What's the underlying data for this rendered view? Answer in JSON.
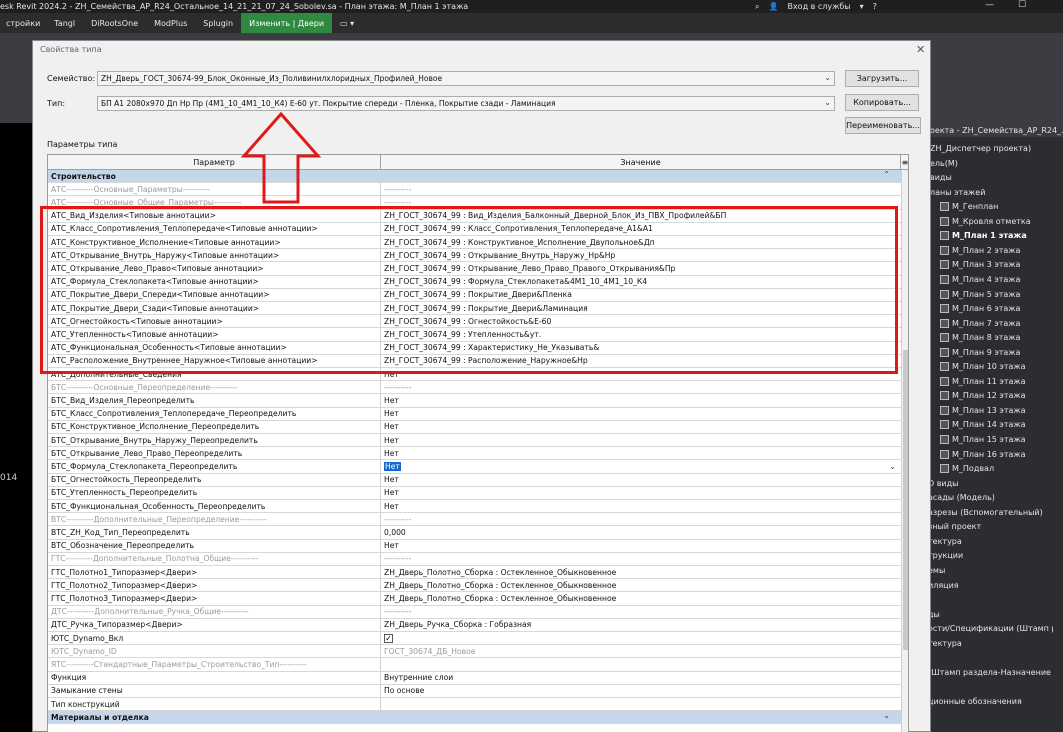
{
  "titlebar": {
    "text": "esk Revit 2024.2 - ZH_Семейства_АР_R24_Остальное_14_21_21_07_24_Sobolev.sa - План этажа: М_План 1 этажа",
    "login": "Вход в службы"
  },
  "menu": [
    "стройки",
    "Tangl",
    "DiRootsOne",
    "ModPlus",
    "Splugin",
    "Изменить | Двери"
  ],
  "dialog": {
    "title": "Свойства типа",
    "family_label": "Семейство:",
    "family_value": "ZH_Дверь_ГОСТ_30674-99_Блок_Оконные_Из_Поливинилхлоридных_Профилей_Новое",
    "type_label": "Тип:",
    "type_value": "БП А1 2080х970 Дп Нр Пр (4М1_10_4М1_10_К4) Е-60 ут.  Покрытие спереди - Пленка, Покрытие сзади - Ламинация",
    "load_button": "Загрузить...",
    "copy_button": "Копировать...",
    "rename_button": "Переименовать...",
    "params_label": "Параметры типа",
    "col_param": "Параметр",
    "col_value": "Значение"
  },
  "rows": [
    {
      "p": "Строительство",
      "v": "",
      "kind": "group"
    },
    {
      "p": "АТС----------Основные_Параметры----------",
      "v": "----------",
      "kind": "grey"
    },
    {
      "p": "АТС----------Основные_Общие_Параметры----------",
      "v": "----------",
      "kind": "grey"
    },
    {
      "p": "АТС_Вид_Изделия<Типовые аннотации>",
      "v": "ZH_ГОСТ_30674_99 : Вид_Изделия_Балконный_Дверной_Блок_Из_ПВХ_Профилей&БП",
      "kind": ""
    },
    {
      "p": "АТС_Класс_Сопротивления_Теплопередаче<Типовые аннотации>",
      "v": "ZH_ГОСТ_30674_99 : Класс_Сопротивления_Теплопередаче_А1&А1",
      "kind": ""
    },
    {
      "p": "АТС_Конструктивное_Исполнение<Типовые аннотации>",
      "v": "ZH_ГОСТ_30674_99 : Конструктивное_Исполнение_Двупольное&Дп",
      "kind": ""
    },
    {
      "p": "АТС_Открывание_Внутрь_Наружу<Типовые аннотации>",
      "v": "ZH_ГОСТ_30674_99 : Открывание_Внутрь_Наружу_Нр&Нр",
      "kind": ""
    },
    {
      "p": "АТС_Открывание_Лево_Право<Типовые аннотации>",
      "v": "ZH_ГОСТ_30674_99 : Открывание_Лево_Право_Правого_Открывания&Пр",
      "kind": ""
    },
    {
      "p": "АТС_Формула_Стеклопакета<Типовые аннотации>",
      "v": "ZH_ГОСТ_30674_99 : Формула_Стеклопакета&4М1_10_4М1_10_К4",
      "kind": ""
    },
    {
      "p": "АТС_Покрытие_Двери_Спереди<Типовые аннотации>",
      "v": "ZH_ГОСТ_30674_99 : Покрытие_Двери&Пленка",
      "kind": ""
    },
    {
      "p": "АТС_Покрытие_Двери_Сзади<Типовые аннотации>",
      "v": "ZH_ГОСТ_30674_99 : Покрытие_Двери&Ламинация",
      "kind": ""
    },
    {
      "p": "АТС_Огнестойкость<Типовые аннотации>",
      "v": "ZH_ГОСТ_30674_99 : Огнестойкость&Е-60",
      "kind": ""
    },
    {
      "p": "АТС_Утепленность<Типовые аннотации>",
      "v": "ZH_ГОСТ_30674_99 : Утепленность&ут.",
      "kind": ""
    },
    {
      "p": "АТС_Функциональная_Особенность<Типовые аннотации>",
      "v": "ZH_ГОСТ_30674_99 : Характеристику_Не_Указывать&",
      "kind": ""
    },
    {
      "p": "АТС_Расположение_Внутреннее_Наружное<Типовые аннотации>",
      "v": "ZH_ГОСТ_30674_99 : Расположение_Наружное&Нр",
      "kind": ""
    },
    {
      "p": "АТС_Дополнительные_Сведения",
      "v": "Нет",
      "kind": ""
    },
    {
      "p": "БТС----------Основные_Переопределение----------",
      "v": "----------",
      "kind": "grey"
    },
    {
      "p": "БТС_Вид_Изделия_Переопределить",
      "v": "Нет",
      "kind": ""
    },
    {
      "p": "БТС_Класс_Сопротивления_Теплопередаче_Переопределить",
      "v": "Нет",
      "kind": ""
    },
    {
      "p": "БТС_Конструктивное_Исполнение_Переопределить",
      "v": "Нет",
      "kind": ""
    },
    {
      "p": "БТС_Открывание_Внутрь_Наружу_Переопределить",
      "v": "Нет",
      "kind": ""
    },
    {
      "p": "БТС_Открывание_Лево_Право_Переопределить",
      "v": "Нет",
      "kind": ""
    },
    {
      "p": "БТС_Формула_Стеклопакета_Переопределить",
      "v": "Нет",
      "kind": "selected"
    },
    {
      "p": "БТС_Огнестойкость_Переопределить",
      "v": "Нет",
      "kind": ""
    },
    {
      "p": "БТС_Утепленность_Переопределить",
      "v": "Нет",
      "kind": ""
    },
    {
      "p": "БТС_Функциональная_Особенность_Переопределить",
      "v": "Нет",
      "kind": ""
    },
    {
      "p": "ВТС----------Дополнительные_Переопределение----------",
      "v": "----------",
      "kind": "grey"
    },
    {
      "p": "ВТС_ZH_Код_Тип_Переопределить",
      "v": "0,000",
      "kind": ""
    },
    {
      "p": "ВТС_Обозначение_Переопределить",
      "v": "Нет",
      "kind": ""
    },
    {
      "p": "ГТС----------Дополнительные_Полотна_Общие----------",
      "v": "----------",
      "kind": "grey"
    },
    {
      "p": "ГТС_Полотно1_Типоразмер<Двери>",
      "v": "ZH_Дверь_Полотно_Сборка : Остекленное_Обыкновенное",
      "kind": ""
    },
    {
      "p": "ГТС_Полотно2_Типоразмер<Двери>",
      "v": "ZH_Дверь_Полотно_Сборка : Остекленное_Обыкновенное",
      "kind": ""
    },
    {
      "p": "ГТС_Полотно3_Типоразмер<Двери>",
      "v": "ZH_Дверь_Полотно_Сборка : Остекленное_Обыкновенное",
      "kind": ""
    },
    {
      "p": "ДТС----------Дополнительные_Ручка_Общие----------",
      "v": "----------",
      "kind": "grey"
    },
    {
      "p": "ДТС_Ручка_Типоразмер<Двери>",
      "v": "ZH_Дверь_Ручка_Сборка : Гобразная",
      "kind": ""
    },
    {
      "p": "ЮТС_Dynamo_Вкл",
      "v": "",
      "kind": "check"
    },
    {
      "p": "ЮТС_Dynamo_ID",
      "v": "ГОСТ_30674_ДБ_Новое",
      "kind": "grey"
    },
    {
      "p": "ЯТС----------Стандартные_Параметры_Строительство_Тип----------",
      "v": "",
      "kind": "grey"
    },
    {
      "p": "Функция",
      "v": "Внутренние слои",
      "kind": ""
    },
    {
      "p": "Замыкание стены",
      "v": "По основе",
      "kind": ""
    },
    {
      "p": "Тип конструкций",
      "v": "",
      "kind": ""
    },
    {
      "p": "Материалы и отделка",
      "v": "",
      "kind": "group"
    }
  ],
  "browser": {
    "title": "оекта - ZH_Семейства_АР_R24_...",
    "items": [
      {
        "t": "ZH_Диспетчер проекта)",
        "x": 2,
        "bold": false,
        "icon": false
      },
      {
        "t": "ель(М)",
        "x": 2,
        "bold": false,
        "icon": false
      },
      {
        "t": "виды",
        "x": 2,
        "bold": false,
        "icon": false
      },
      {
        "t": "ланы этажей",
        "x": 2,
        "bold": false,
        "icon": false
      },
      {
        "t": "М_Генплан",
        "x": 12,
        "bold": false,
        "icon": true
      },
      {
        "t": "М_Кровля отметка",
        "x": 12,
        "bold": false,
        "icon": true
      },
      {
        "t": "М_План 1 этажа",
        "x": 12,
        "bold": true,
        "icon": true
      },
      {
        "t": "М_План 2 этажа",
        "x": 12,
        "bold": false,
        "icon": true
      },
      {
        "t": "М_План 3 этажа",
        "x": 12,
        "bold": false,
        "icon": true
      },
      {
        "t": "М_План 4 этажа",
        "x": 12,
        "bold": false,
        "icon": true
      },
      {
        "t": "М_План 5 этажа",
        "x": 12,
        "bold": false,
        "icon": true
      },
      {
        "t": "М_План 6 этажа",
        "x": 12,
        "bold": false,
        "icon": true
      },
      {
        "t": "М_План 7 этажа",
        "x": 12,
        "bold": false,
        "icon": true
      },
      {
        "t": "М_План 8 этажа",
        "x": 12,
        "bold": false,
        "icon": true
      },
      {
        "t": "М_План 9 этажа",
        "x": 12,
        "bold": false,
        "icon": true
      },
      {
        "t": "М_План 10 этажа",
        "x": 12,
        "bold": false,
        "icon": true
      },
      {
        "t": "М_План 11 этажа",
        "x": 12,
        "bold": false,
        "icon": true
      },
      {
        "t": "М_План 12 этажа",
        "x": 12,
        "bold": false,
        "icon": true
      },
      {
        "t": "М_План 13 этажа",
        "x": 12,
        "bold": false,
        "icon": true
      },
      {
        "t": "М_План 14 этажа",
        "x": 12,
        "bold": false,
        "icon": true
      },
      {
        "t": "М_План 15 этажа",
        "x": 12,
        "bold": false,
        "icon": true
      },
      {
        "t": "М_План 16 этажа",
        "x": 12,
        "bold": false,
        "icon": true
      },
      {
        "t": "М_Подвал",
        "x": 12,
        "bold": false,
        "icon": true
      },
      {
        "t": "D виды",
        "x": 0,
        "bold": false,
        "icon": false
      },
      {
        "t": "асады (Модель)",
        "x": 0,
        "bold": false,
        "icon": false
      },
      {
        "t": "азрезы (Вспомогательный)",
        "x": 0,
        "bold": false,
        "icon": false
      },
      {
        "t": "зный проект",
        "x": 0,
        "bold": false,
        "icon": false
      },
      {
        "t": "тектура",
        "x": 0,
        "bold": false,
        "icon": false
      },
      {
        "t": "трукции",
        "x": 0,
        "bold": false,
        "icon": false
      },
      {
        "t": "емы",
        "x": 0,
        "bold": false,
        "icon": false
      },
      {
        "t": "иляция",
        "x": 0,
        "bold": false,
        "icon": false
      },
      {
        "t": "",
        "x": 0,
        "bold": false,
        "icon": false
      },
      {
        "t": "ды",
        "x": 0,
        "bold": false,
        "icon": false
      },
      {
        "t": "ости/Спецификации (Штамп р",
        "x": 0,
        "bold": false,
        "icon": false
      },
      {
        "t": "тектура",
        "x": 0,
        "bold": false,
        "icon": false
      },
      {
        "t": "",
        "x": 0,
        "bold": false,
        "icon": false
      },
      {
        "t": "(Штамп раздела-Назначение",
        "x": 0,
        "bold": false,
        "icon": false
      },
      {
        "t": "",
        "x": 0,
        "bold": false,
        "icon": false
      },
      {
        "t": "ционные обозначения",
        "x": 0,
        "bold": false,
        "icon": false
      }
    ]
  },
  "canvas_label": "014",
  "colors": {
    "annotation": "#e01818",
    "group_row": "#c6d6ea",
    "active_tab": "#2d8a3e",
    "selection": "#1569c7"
  }
}
